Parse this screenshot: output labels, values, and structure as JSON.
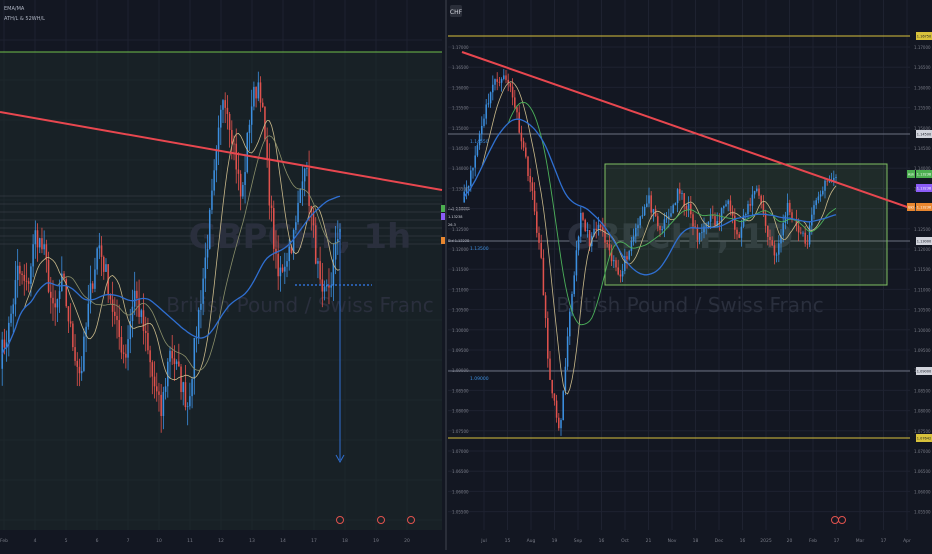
{
  "colors": {
    "background": "#131722",
    "grid": "#1e2230",
    "candle_up": "#3c8fe0",
    "candle_down": "#e0524d",
    "trendline": "#e8474f",
    "ema_blue": "#2f6fd1",
    "ma_thin": "#c9b98a",
    "ma_green": "#4cb15a",
    "yellow_level": "#d8c23c",
    "green_level": "#6fbf4a",
    "range_box_border": "#7fbf63",
    "price_bid": "#e8862f",
    "price_ask": "#4caf50",
    "price_mid": "#8b5cf6",
    "watermark": "#2a2f3d"
  },
  "panels": {
    "left": {
      "watermark_symbol": "GBPCHF, 1h",
      "watermark_name": "British Pound / Swiss Franc",
      "legend": [
        "EMA/MA",
        "ATH/L & 52WH/L"
      ],
      "currency_badge": "",
      "price_tags": [
        {
          "key": "ask",
          "label": "Ask",
          "value": "1.13238"
        },
        {
          "key": "mid",
          "label": "",
          "value": "1.13238"
        },
        {
          "key": "spread",
          "label": "",
          "value": "26.3"
        },
        {
          "key": "bid",
          "label": "Bid",
          "value": "1.13238"
        }
      ],
      "x_labels": [
        "Feb",
        "4",
        "5",
        "6",
        "7",
        "10",
        "11",
        "12",
        "13",
        "14",
        "17",
        "18",
        "19",
        "20"
      ]
    },
    "right": {
      "watermark_symbol": "GBPCHF, 1D",
      "watermark_name": "British Pound / Swiss Franc",
      "currency_badge": "CHF",
      "level_labels": [
        {
          "key": "l1",
          "text": "1.14550"
        },
        {
          "key": "l2",
          "text": "1.13500"
        },
        {
          "key": "l3",
          "text": "1.09000"
        }
      ],
      "y_labels": [
        "1.17000",
        "1.16500",
        "1.16000",
        "1.15500",
        "1.15000",
        "1.14500",
        "1.14000",
        "1.13500",
        "1.13000",
        "1.12500",
        "1.12000",
        "1.11500",
        "1.11000",
        "1.10500",
        "1.10000",
        "1.09500",
        "1.09000",
        "1.08500",
        "1.08000",
        "1.07500",
        "1.07000",
        "1.06500",
        "1.06000",
        "1.05500"
      ],
      "price_tags": [
        {
          "key": "yellow_top",
          "label": "",
          "value": "1.16750"
        },
        {
          "key": "level_145",
          "label": "",
          "value": "1.14500"
        },
        {
          "key": "ask",
          "label": "Ask",
          "value": "1.13238"
        },
        {
          "key": "mid",
          "label": "",
          "value": "1.13238"
        },
        {
          "key": "bid",
          "label": "Bid",
          "value": "1.13236"
        },
        {
          "key": "level_130",
          "label": "",
          "value": "1.13000"
        },
        {
          "key": "level_090",
          "label": "",
          "value": "1.09000"
        },
        {
          "key": "yellow_bottom",
          "label": "",
          "value": "1.07642"
        }
      ],
      "x_labels": [
        "Jul",
        "15",
        "Aug",
        "19",
        "Sep",
        "16",
        "Oct",
        "21",
        "Nov",
        "18",
        "Dec",
        "16",
        "2025",
        "20",
        "Feb",
        "17",
        "Mar",
        "17",
        "Apr"
      ]
    }
  },
  "chart_data": [
    {
      "type": "line",
      "title": "GBPCHF, 1h",
      "xlabel": "",
      "ylabel": "",
      "series": [
        {
          "values": [
            0.34,
            0.4,
            0.52,
            0.48,
            0.6,
            0.55,
            0.42,
            0.5,
            0.38,
            0.3,
            0.46,
            0.58,
            0.5,
            0.4,
            0.34,
            0.48,
            0.4,
            0.3,
            0.22,
            0.36,
            0.3,
            0.24,
            0.4,
            0.55,
            0.72,
            0.9,
            0.8,
            0.66,
            0.86,
            0.92,
            0.7,
            0.5,
            0.55,
            0.6,
            0.76,
            0.6,
            0.45,
            0.5,
            0.62
          ]
        }
      ],
      "legend": "none",
      "grid": true
    },
    {
      "type": "line",
      "title": "GBPCHF, 1D",
      "xlabel": "",
      "ylabel": "",
      "ylim": [
        1.055,
        1.17
      ],
      "series": [
        {
          "values": [
            1.133,
            1.139,
            1.151,
            1.16,
            1.163,
            1.16,
            1.148,
            1.136,
            1.118,
            1.085,
            1.075,
            1.105,
            1.128,
            1.122,
            1.126,
            1.118,
            1.114,
            1.12,
            1.128,
            1.132,
            1.124,
            1.128,
            1.134,
            1.13,
            1.122,
            1.128,
            1.126,
            1.134,
            1.122,
            1.13,
            1.136,
            1.124,
            1.118,
            1.131,
            1.126,
            1.121,
            1.133,
            1.136,
            1.138
          ]
        }
      ],
      "legend": "none",
      "grid": true
    }
  ]
}
